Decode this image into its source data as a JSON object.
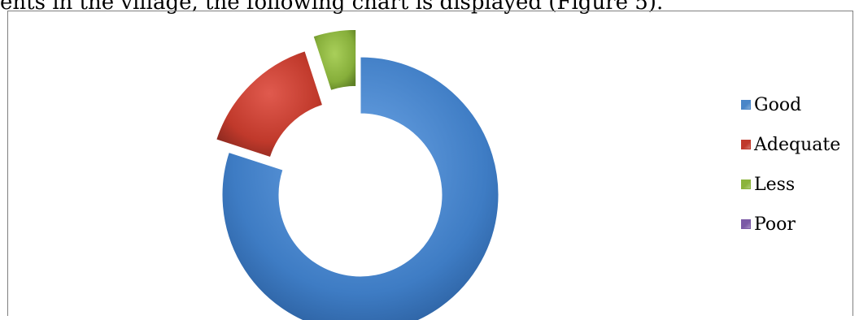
{
  "document": {
    "caption_text": "ents in the village, the following chart is displayed (Figure 5)."
  },
  "chart_data": {
    "type": "pie",
    "variant": "doughnut",
    "categories": [
      "Good",
      "Adequate",
      "Less",
      "Poor"
    ],
    "values": [
      80,
      15,
      5,
      0
    ],
    "colors": [
      "#4a86c8",
      "#c0392b",
      "#8cb43c",
      "#7b5aa6"
    ],
    "exploded": true,
    "legend_position": "right",
    "title": ""
  }
}
